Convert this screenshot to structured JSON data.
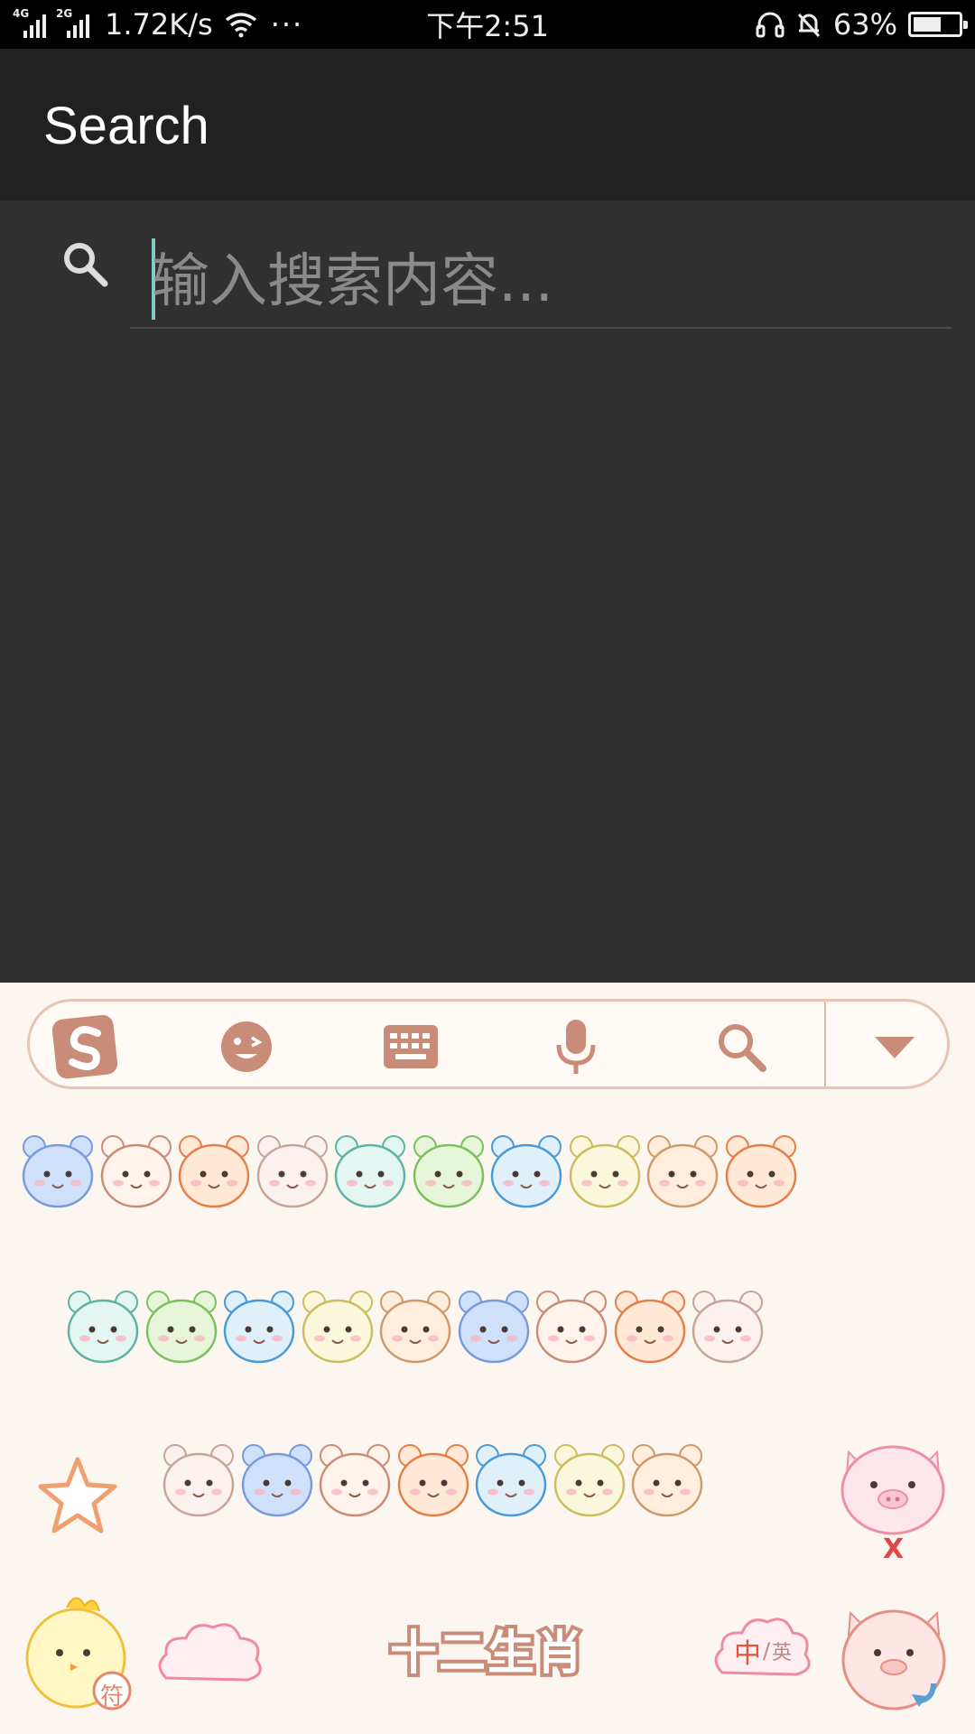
{
  "status_bar": {
    "net1": "4G",
    "net2": "2G",
    "speed": "1.72K/s",
    "more": "···",
    "time": "下午2:51",
    "battery_percent_text": "63%",
    "battery_level": 0.63
  },
  "app_bar": {
    "title": "Search"
  },
  "search": {
    "placeholder": "输入搜索内容..."
  },
  "keyboard": {
    "toolbar": [
      {
        "name": "sogou-logo-icon"
      },
      {
        "name": "emoji-face-icon"
      },
      {
        "name": "keyboard-icon"
      },
      {
        "name": "microphone-icon"
      },
      {
        "name": "search-icon"
      },
      {
        "name": "collapse-down-icon"
      }
    ],
    "symbol_key_label": "符",
    "space_label": "十二生肖",
    "lang_zh": "中",
    "lang_en": "英",
    "delete_mark": "X",
    "colors": {
      "background": "#fcf6f0",
      "accent": "#c98c78",
      "icon": "#c98c78"
    }
  }
}
